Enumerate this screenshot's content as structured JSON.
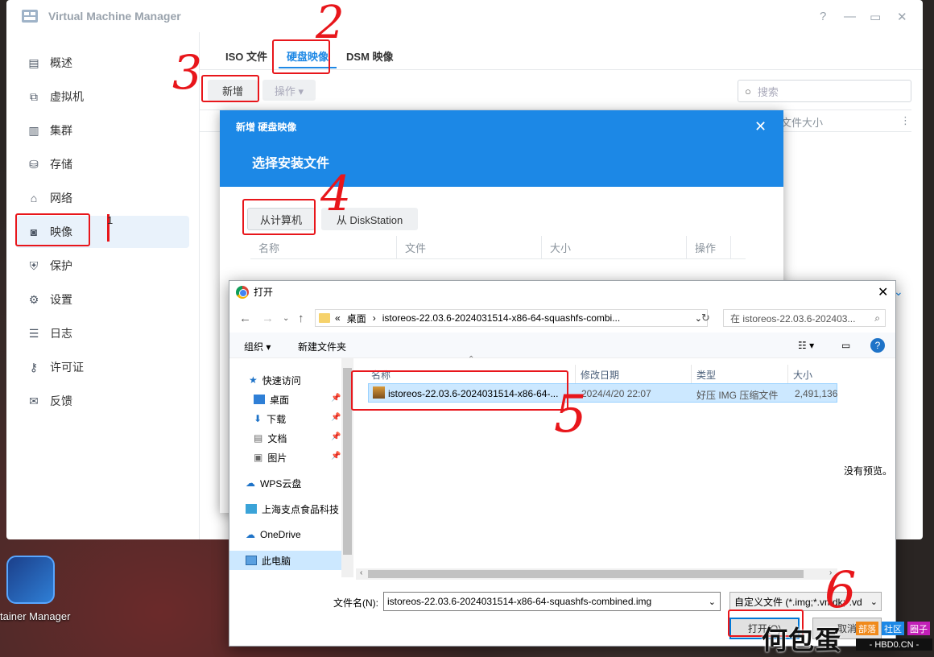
{
  "vmm": {
    "title": "Virtual Machine Manager",
    "controls": [
      "?",
      "—",
      "▭",
      "✕"
    ],
    "sidebar": [
      {
        "label": "概述",
        "icon": "overview-icon",
        "active": false
      },
      {
        "label": "虚拟机",
        "icon": "vm-icon",
        "active": false
      },
      {
        "label": "集群",
        "icon": "cluster-icon",
        "active": false
      },
      {
        "label": "存储",
        "icon": "storage-icon",
        "active": false
      },
      {
        "label": "网络",
        "icon": "network-icon",
        "active": false
      },
      {
        "label": "映像",
        "icon": "image-icon",
        "active": true
      },
      {
        "label": "保护",
        "icon": "shield-icon",
        "active": false
      },
      {
        "label": "设置",
        "icon": "gear-icon",
        "active": false
      },
      {
        "label": "日志",
        "icon": "log-icon",
        "active": false
      },
      {
        "label": "许可证",
        "icon": "key-icon",
        "active": false
      },
      {
        "label": "反馈",
        "icon": "mail-icon",
        "active": false
      }
    ],
    "tabs": [
      "ISO 文件",
      "硬盘映像",
      "DSM 映像"
    ],
    "add_button": "新增",
    "action_button": "操作 ▾",
    "search_placeholder": "搜索",
    "col_file_size": "文件大小"
  },
  "modal": {
    "title_small": "新增 硬盘映像",
    "title_big": "选择安装文件",
    "btn_from_computer": "从计算机",
    "btn_from_diskstation": "从 DiskStation",
    "columns": [
      "名称",
      "文件",
      "大小",
      "操作"
    ]
  },
  "open_dialog": {
    "title": "打开",
    "address": [
      "«",
      "桌面",
      "›",
      "istoreos-22.03.6-2024031514-x86-64-squashfs-combi..."
    ],
    "search_placeholder": "在 istoreos-22.03.6-202403...",
    "organize": "组织 ▾",
    "new_folder": "新建文件夹",
    "tree": [
      {
        "label": "快速访问",
        "icon": "star-icon",
        "pin": false
      },
      {
        "label": "桌面",
        "icon": "desktop-icon",
        "pin": true
      },
      {
        "label": "下载",
        "icon": "download-icon",
        "pin": true
      },
      {
        "label": "文档",
        "icon": "document-icon",
        "pin": true
      },
      {
        "label": "图片",
        "icon": "picture-icon",
        "pin": true
      },
      {
        "label": "WPS云盘",
        "icon": "cloud-icon",
        "pin": false
      },
      {
        "label": "上海支点食品科技",
        "icon": "building-icon",
        "pin": false
      },
      {
        "label": "OneDrive",
        "icon": "onedrive-icon",
        "pin": false
      },
      {
        "label": "此电脑",
        "icon": "computer-icon",
        "pin": false
      }
    ],
    "file_headers": [
      "名称",
      "修改日期",
      "类型",
      "大小"
    ],
    "file": {
      "name": "istoreos-22.03.6-2024031514-x86-64-...",
      "date": "2024/4/20 22:07",
      "type": "好压 IMG 压缩文件",
      "size": "2,491,136"
    },
    "no_preview": "没有预览。",
    "filename_label": "文件名(N):",
    "filename_value": "istoreos-22.03.6-2024031514-x86-64-squashfs-combined.img",
    "filetype_value": "自定义文件 (*.img;*.vmdk;*.vd",
    "open_button": "打开(O)",
    "cancel_button": "取消"
  },
  "desktop": {
    "icon_label": "tainer Manager"
  },
  "annotations": [
    "1",
    "2",
    "3",
    "4",
    "5",
    "6"
  ],
  "watermark": {
    "text": "何包蛋",
    "badges": [
      "部落",
      "社区",
      "圈子"
    ],
    "url": "- HBD0.CN -"
  },
  "colors": {
    "accent": "#1c88e6",
    "annotation_red": "#e8161b",
    "selection": "#cce8ff"
  }
}
